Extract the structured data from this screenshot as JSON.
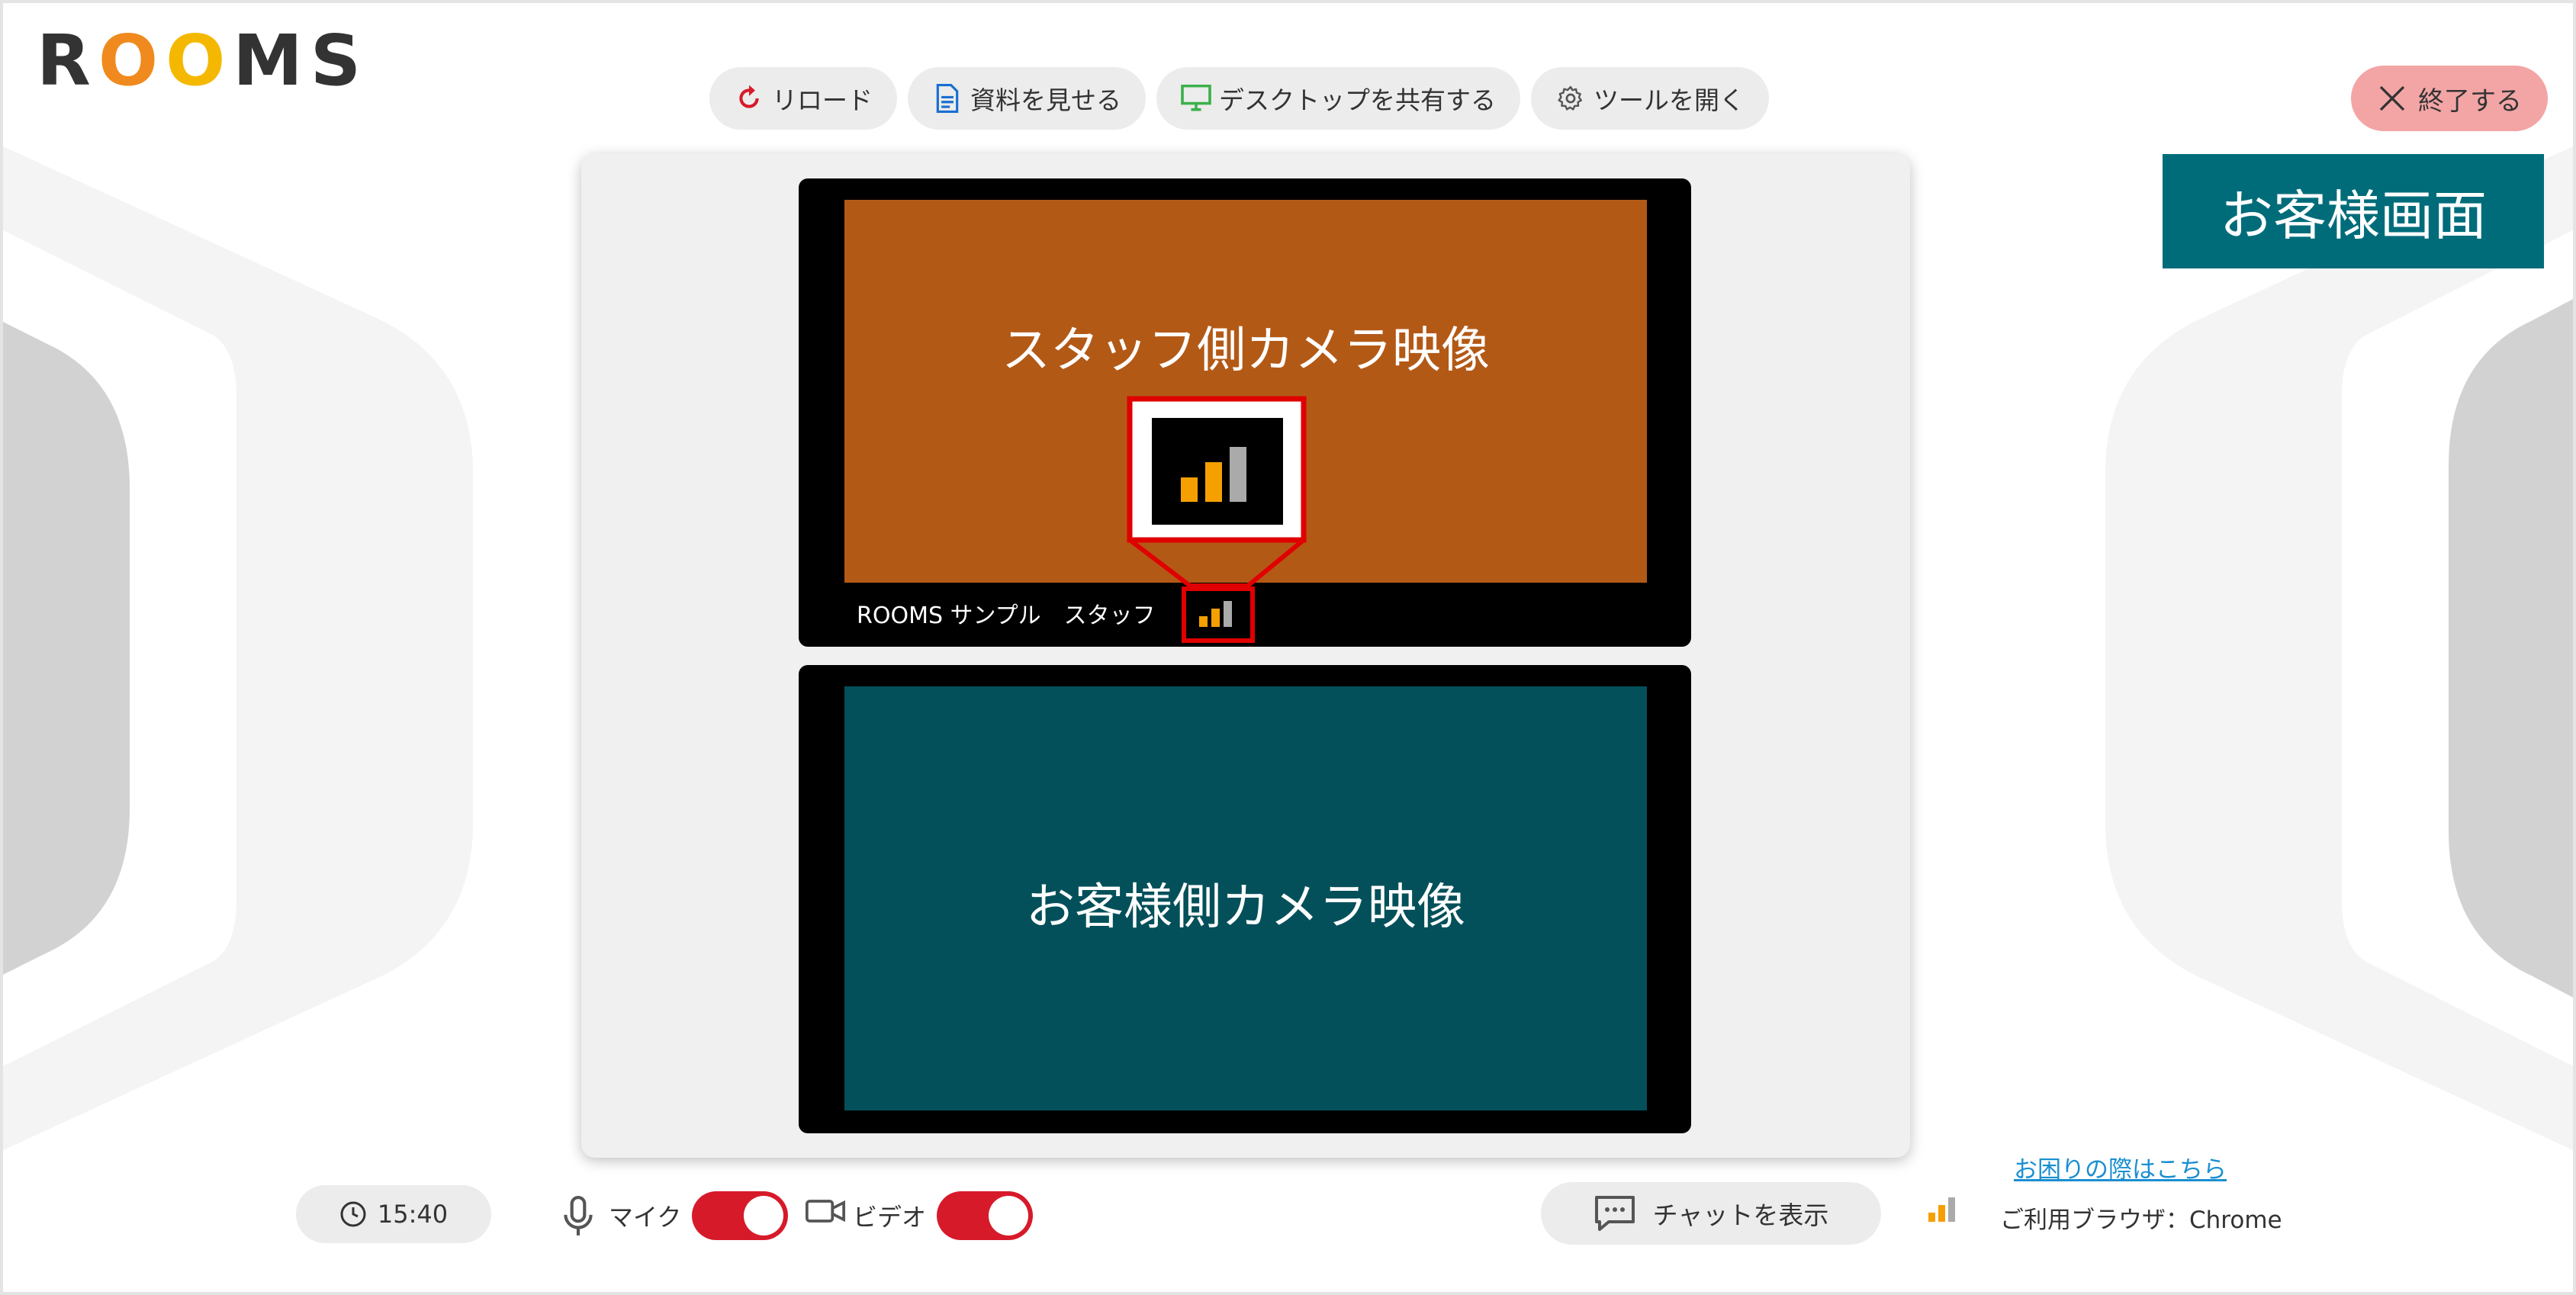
{
  "logo": {
    "letters": [
      "R",
      "O",
      "O",
      "M",
      "S"
    ],
    "colors": [
      "#333333",
      "#f08a1e",
      "#f5b800",
      "#333333",
      "#333333"
    ]
  },
  "toolbar": {
    "reload": {
      "label": "リロード",
      "icon": "reload-icon"
    },
    "show_document": {
      "label": "資料を見せる",
      "icon": "document-icon"
    },
    "share_desktop": {
      "label": "デスクトップを共有する",
      "icon": "monitor-icon"
    },
    "open_tools": {
      "label": "ツールを開く",
      "icon": "gear-icon"
    }
  },
  "end_button": {
    "label": "終了する",
    "icon": "close-icon"
  },
  "screen_label": "お客様画面",
  "staff_video": {
    "caption": "スタッフ側カメラ映像",
    "name": "ROOMS サンプル　スタッフ",
    "signal_icon": "signal-strength-icon",
    "signal_level": 2,
    "signal_max": 3
  },
  "customer_video": {
    "caption": "お客様側カメラ映像"
  },
  "bottom": {
    "time": "15:40",
    "mic_label": "マイク",
    "mic_on": true,
    "video_label": "ビデオ",
    "video_on": true,
    "chat_label": "チャットを表示",
    "help_link": "お困りの際はこちら",
    "browser_info": "ご利用ブラウザ：Chrome"
  },
  "colors": {
    "accent_red": "#d71a2a",
    "teal_label": "#006c7a",
    "staff_feed": "#b35916",
    "customer_feed": "#03505a",
    "signal_orange": "#f5a000",
    "signal_gray": "#aaaaaa",
    "callout_red": "#e00000"
  }
}
